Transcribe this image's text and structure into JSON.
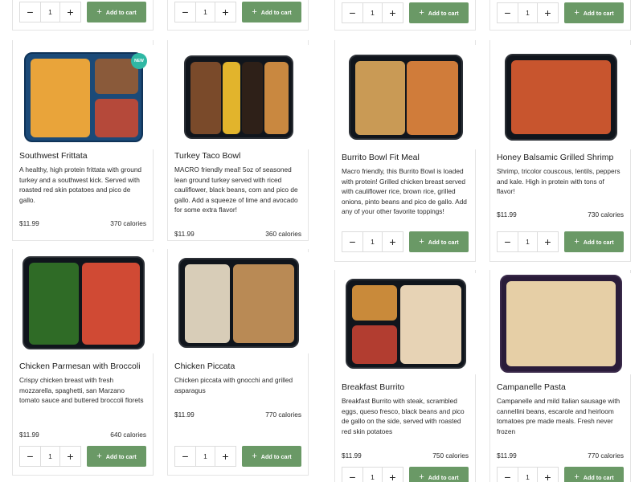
{
  "cart": {
    "add_label": "Add to cart",
    "plus": "+",
    "minus": "−",
    "default_qty": "1"
  },
  "products": [
    {
      "title": "Southwest Frittata",
      "description": "A healthy, high protein frittata with ground turkey and a southwest kick. Served with roasted red skin potatoes and pico de gallo.",
      "price": "$11.99",
      "calories": "370 calories",
      "badge": "NEW"
    },
    {
      "title": "Turkey Taco Bowl",
      "description": "MACRO friendly meal! 5oz of seasoned lean ground turkey served with riced cauliflower, black beans, corn and pico de gallo. Add a squeeze of lime and avocado for some extra flavor!",
      "price": "$11.99",
      "calories": "360 calories"
    },
    {
      "title": "Burrito Bowl Fit Meal",
      "description": "Macro friendly, this Burrito Bowl is loaded with protein! Grilled chicken breast served with cauliflower rice, brown rice, grilled onions, pinto beans and pico de gallo. Add any of your other favorite toppings!",
      "price": "",
      "calories": ""
    },
    {
      "title": "Honey Balsamic Grilled Shrimp",
      "description": "Shrimp, tricolor couscous, lentils, peppers and kale. High in protein with tons of flavor!",
      "price": "$11.99",
      "calories": "730 calories"
    },
    {
      "title": "Chicken Parmesan with Broccoli",
      "description": "Crispy chicken breast with fresh mozzarella, spaghetti, san Marzano tomato sauce and buttered broccoli florets",
      "price": "$11.99",
      "calories": "640 calories"
    },
    {
      "title": "Chicken Piccata",
      "description": "Chicken piccata with gnocchi and grilled asparagus",
      "price": "$11.99",
      "calories": "770 calories"
    },
    {
      "title": "Breakfast Burrito",
      "description": "Breakfast Burrito with steak, scrambled eggs, queso fresco, black beans and pico de gallo on the side, served with roasted red skin potatoes",
      "price": "$11.99",
      "calories": "750 calories"
    },
    {
      "title": "Campanelle Pasta",
      "description": "Campanelle and mild Italian sausage with cannellini beans, escarole and heirloom tomatoes pre made meals. Fresh never frozen",
      "price": "$11.99",
      "calories": "770 calories"
    }
  ]
}
